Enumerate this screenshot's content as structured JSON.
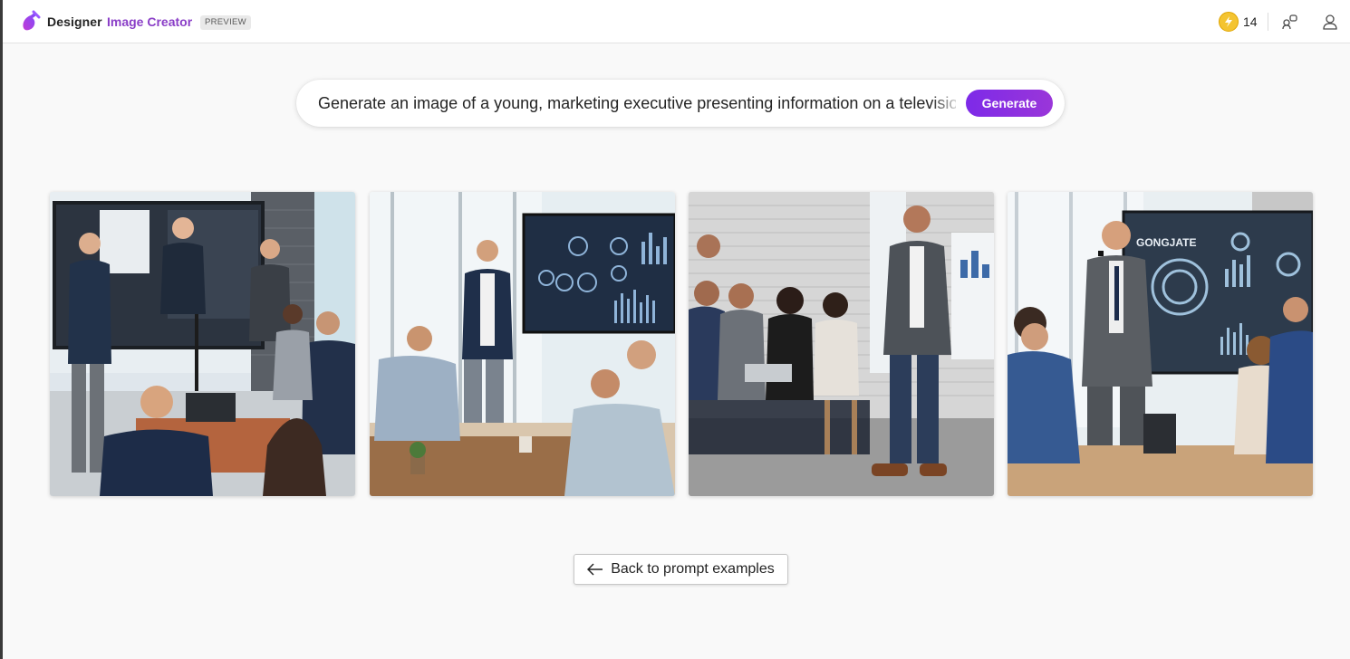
{
  "header": {
    "brand": "Designer",
    "product": "Image Creator",
    "badge": "PREVIEW",
    "coins": "14",
    "icons": {
      "logo": "designer-logo-icon",
      "coin": "boost-coin-icon",
      "share": "share-icon",
      "profile": "profile-icon"
    }
  },
  "prompt": {
    "value": "Generate an image of a young, marketing executive presenting information on a television screen to a team",
    "button": "Generate"
  },
  "images": [
    {
      "name": "generated-image-1"
    },
    {
      "name": "generated-image-2"
    },
    {
      "name": "generated-image-3"
    },
    {
      "name": "generated-image-4"
    }
  ],
  "tile4_sign": "GONGJATE",
  "back": {
    "label": "Back to prompt examples",
    "icon": "arrow-left-icon"
  },
  "colors": {
    "accent": "#8a2be2",
    "product_text": "#8a3ec7",
    "coin": "#f4c431"
  }
}
